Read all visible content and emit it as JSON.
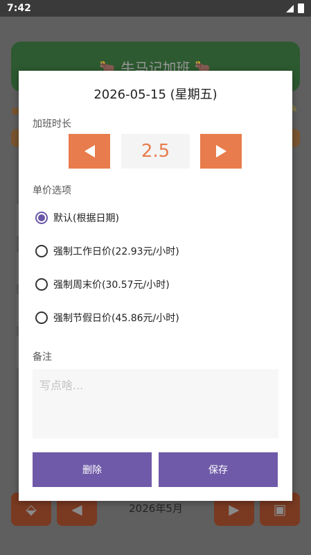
{
  "status_bar": {
    "time": "7:42"
  },
  "background": {
    "app_title": "🐂 牛马记加班 🐂",
    "month_label": "2026年5月"
  },
  "dialog": {
    "title": "2026-05-15 (星期五)",
    "hours_label": "加班时长",
    "hours_value": "2.5",
    "rate_label": "单价选项",
    "rate_options": [
      {
        "label": "默认(根据日期)",
        "checked": true
      },
      {
        "label": "强制工作日价(22.93元/小时)",
        "checked": false
      },
      {
        "label": "强制周末价(30.57元/小时)",
        "checked": false
      },
      {
        "label": "强制节假日价(45.86元/小时)",
        "checked": false
      }
    ],
    "note_label": "备注",
    "note_placeholder": "写点啥...",
    "note_value": "",
    "delete_label": "删除",
    "save_label": "保存"
  },
  "colors": {
    "accent_orange": "#e87c4c",
    "accent_purple": "#6e5aa8",
    "header_green": "#2d5a30"
  }
}
